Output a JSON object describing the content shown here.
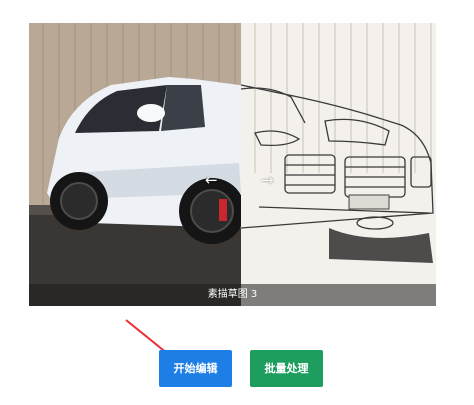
{
  "preview": {
    "caption": "素描草图 3",
    "image": "car-photo-vs-sketch-comparison",
    "left_half": "photo",
    "right_half": "pencil-sketch"
  },
  "compare_icons": {
    "left": "←",
    "right": "→"
  },
  "actions": {
    "start_edit_label": "开始编辑",
    "batch_label": "批量处理"
  },
  "annotation": {
    "arrow_color": "#e8323a"
  },
  "colors": {
    "primary": "#1d7fe6",
    "secondary": "#1d9e5f"
  }
}
